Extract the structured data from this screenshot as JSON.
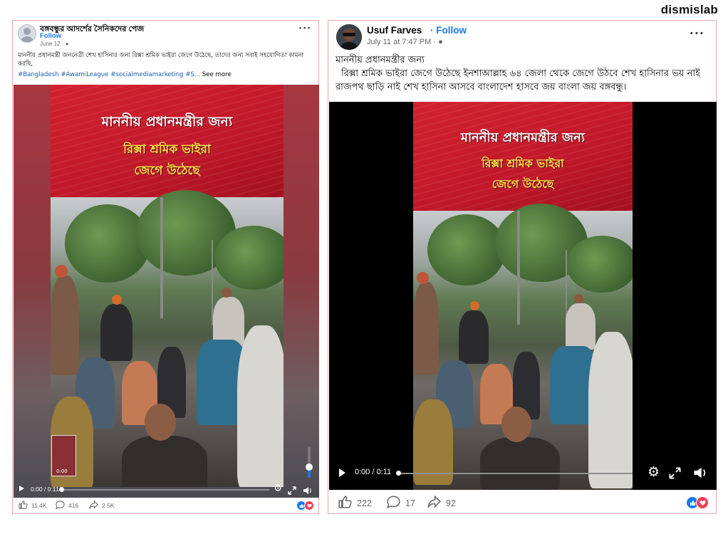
{
  "brand": "dismislab",
  "posts": [
    {
      "page_name": "বঙ্গবন্ধুর আদর্শের সৈনিকদের পেজ",
      "follow_label": "Follow",
      "date": "June 12",
      "caption": "মাননীয় প্রধানমন্ত্রী জননেত্রী শেখ হাসিনার জন্য রিক্সা শ্রমিক ভাইরা জেগে উঠেছে, তাদের জন্য সবাই সহযোগিতা কামনা করছি,",
      "hashtags": "#Bangladesh #AwamiLeague #socialmediamarketing #S...",
      "see_more": "See more",
      "banner_line1": "মাননীয় প্রধানমন্ত্রীর জন্য",
      "banner_line2": "রিক্সা শ্রমিক ভাইরা",
      "banner_line3": "জেগে উঠেছে",
      "thumb_time": "0:00",
      "video_time": "0:00 / 0:11",
      "likes": "11.4K",
      "comments": "416",
      "shares": "2.5K"
    },
    {
      "page_name": "Usuf Farves",
      "follow_label": "Follow",
      "date": "July 11 at 7:47 PM",
      "caption_line1": "মাননীয় প্রধানমন্ত্রীর জন্য",
      "caption_line2": "রিক্সা শ্রমিক ভাইরা জেগে উঠেছে ইনশাআল্লাহ ৬৪ জেলা থেকে জেগে উঠবে শেখ হাসিনার ভয় নাই রাজপথ ছাড়ি নাই শেখ হাসিনা আসবে বাংলাদেশ হাসবে জয় বাংলা জয় বঙ্গবন্ধু।",
      "banner_line1": "মাননীয় প্রধানমন্ত্রীর জন্য",
      "banner_line2": "রিক্সা শ্রমিক ভাইরা",
      "banner_line3": "জেগে উঠেছে",
      "video_time": "0:00 / 0:11",
      "likes": "222",
      "comments": "17",
      "shares": "92"
    }
  ],
  "icons": {
    "public": "globe-icon",
    "more": "more-options-icon",
    "play": "play-icon",
    "settings": "gear-icon",
    "fullscreen": "expand-icon",
    "volume": "speaker-icon",
    "like": "thumbs-up-icon",
    "comment": "comment-icon",
    "share": "share-icon"
  },
  "colors": {
    "follow": "#1877f2",
    "banner_red": "#c8182b",
    "banner_yellow": "#ffe24a",
    "like_blue": "#1877f2",
    "love_red": "#f33e58"
  },
  "video_progress": 0,
  "volume_level": 0.35
}
